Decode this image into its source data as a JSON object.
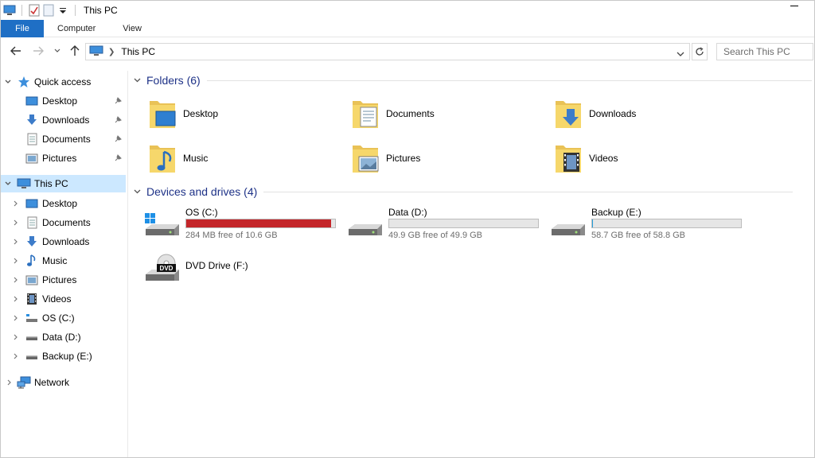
{
  "window": {
    "title": "This PC"
  },
  "ribbon": {
    "tabs": [
      "File",
      "Computer",
      "View"
    ]
  },
  "address": {
    "crumb": "This PC",
    "search_placeholder": "Search This PC"
  },
  "nav": {
    "quick_access": "Quick access",
    "quick_items": [
      "Desktop",
      "Downloads",
      "Documents",
      "Pictures"
    ],
    "this_pc": "This PC",
    "pc_items": [
      "Desktop",
      "Documents",
      "Downloads",
      "Music",
      "Pictures",
      "Videos",
      "OS (C:)",
      "Data (D:)",
      "Backup (E:)"
    ],
    "network": "Network"
  },
  "content": {
    "folders_header": "Folders (6)",
    "folders": [
      "Desktop",
      "Documents",
      "Downloads",
      "Music",
      "Pictures",
      "Videos"
    ],
    "drives_header": "Devices and drives (4)",
    "drives": [
      {
        "name": "OS (C:)",
        "free": "284 MB free of 10.6 GB",
        "used_fraction": 0.974,
        "bar_color": "#c4262a"
      },
      {
        "name": "Data (D:)",
        "free": "49.9 GB free of 49.9 GB",
        "used_fraction": 0.0,
        "bar_color": "#26a0da"
      },
      {
        "name": "Backup (E:)",
        "free": "58.7 GB free of 58.8 GB",
        "used_fraction": 0.002,
        "bar_color": "#26a0da"
      },
      {
        "name": "DVD Drive (F:)"
      }
    ]
  },
  "colors": {
    "accent": "#1f6fc5",
    "selection": "#cce8ff",
    "group_header": "#1e3287",
    "folder": "#f6d76b"
  }
}
